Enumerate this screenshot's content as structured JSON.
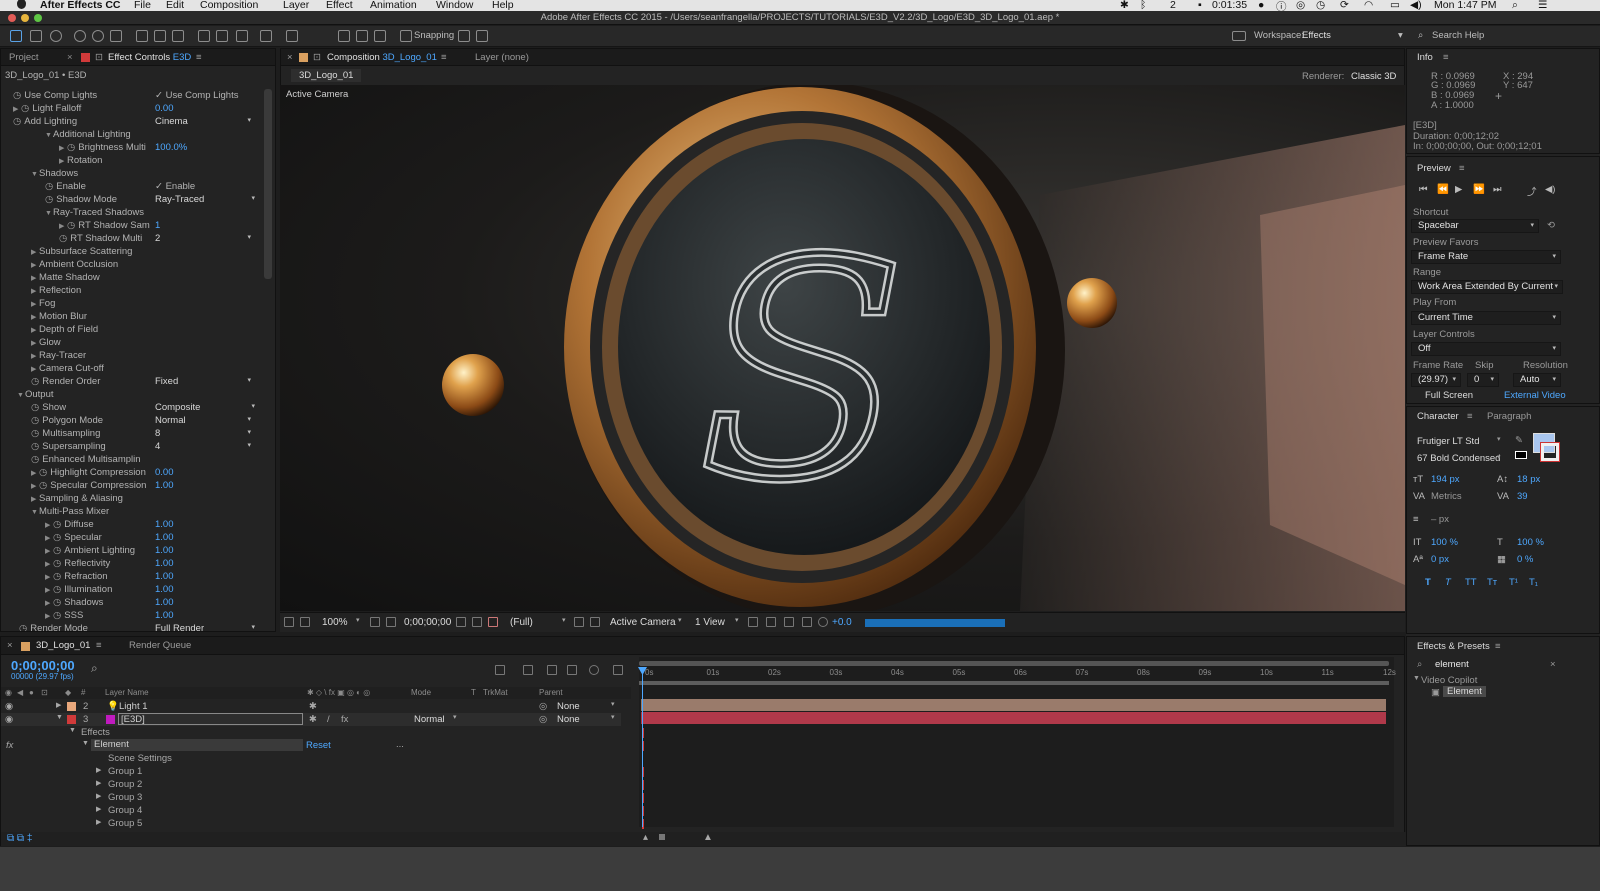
{
  "menubar": {
    "app": "After Effects CC",
    "items": [
      "File",
      "Edit",
      "Composition",
      "Layer",
      "Effect",
      "Animation",
      "Window",
      "Help"
    ],
    "status_count": "2",
    "time_indicator": "0:01:35",
    "clock": "Mon 1:47 PM"
  },
  "window": {
    "title": "Adobe After Effects CC 2015 - /Users/seanfrangella/PROJECTS/TUTORIALS/E3D_V2.2/3D_Logo/E3D_3D_Logo_01.aep *"
  },
  "toolbar": {
    "snapping": "Snapping",
    "workspace_label": "Workspace:",
    "workspace_value": "Effects",
    "search_help": "Search Help"
  },
  "effect_controls": {
    "tabs": {
      "project": "Project",
      "effect_controls_prefix": "Effect Controls",
      "effect_controls_layer": "E3D"
    },
    "header": "3D_Logo_01 • E3D",
    "rows": [
      {
        "label": "Use Comp Lights",
        "value": "✓ Use Comp Lights"
      },
      {
        "label": "Light Falloff",
        "value": "0.00"
      },
      {
        "label": "Add Lighting",
        "value": "Cinema"
      },
      {
        "label": "Additional Lighting",
        "value": ""
      },
      {
        "label": "Brightness Multi",
        "value": "100.0%"
      },
      {
        "label": "Rotation",
        "value": ""
      },
      {
        "label": "Shadows",
        "value": ""
      },
      {
        "label": "Enable",
        "value": "✓ Enable"
      },
      {
        "label": "Shadow Mode",
        "value": "Ray-Traced"
      },
      {
        "label": "Ray-Traced Shadows",
        "value": ""
      },
      {
        "label": "RT Shadow Sam",
        "value": "1"
      },
      {
        "label": "RT Shadow Multi",
        "value": "2"
      },
      {
        "label": "Subsurface Scattering",
        "value": ""
      },
      {
        "label": "Ambient Occlusion",
        "value": ""
      },
      {
        "label": "Matte Shadow",
        "value": ""
      },
      {
        "label": "Reflection",
        "value": ""
      },
      {
        "label": "Fog",
        "value": ""
      },
      {
        "label": "Motion Blur",
        "value": ""
      },
      {
        "label": "Depth of Field",
        "value": ""
      },
      {
        "label": "Glow",
        "value": ""
      },
      {
        "label": "Ray-Tracer",
        "value": ""
      },
      {
        "label": "Camera Cut-off",
        "value": ""
      },
      {
        "label": "Render Order",
        "value": "Fixed"
      },
      {
        "label": "Output",
        "value": ""
      },
      {
        "label": "Show",
        "value": "Composite"
      },
      {
        "label": "Polygon Mode",
        "value": "Normal"
      },
      {
        "label": "Multisampling",
        "value": "8"
      },
      {
        "label": "Supersampling",
        "value": "4"
      },
      {
        "label": "Enhanced Multisamplin",
        "value": ""
      },
      {
        "label": "Highlight Compression",
        "value": "0.00"
      },
      {
        "label": "Specular Compression",
        "value": "1.00"
      },
      {
        "label": "Sampling & Aliasing",
        "value": ""
      },
      {
        "label": "Multi-Pass Mixer",
        "value": ""
      },
      {
        "label": "Diffuse",
        "value": "1.00"
      },
      {
        "label": "Specular",
        "value": "1.00"
      },
      {
        "label": "Ambient Lighting",
        "value": "1.00"
      },
      {
        "label": "Reflectivity",
        "value": "1.00"
      },
      {
        "label": "Refraction",
        "value": "1.00"
      },
      {
        "label": "Illumination",
        "value": "1.00"
      },
      {
        "label": "Shadows",
        "value": "1.00"
      },
      {
        "label": "SSS",
        "value": "1.00"
      },
      {
        "label": "Render Mode",
        "value": "Full Render"
      }
    ]
  },
  "composition": {
    "tab_prefix": "Composition",
    "tab_name": "3D_Logo_01",
    "layer_tab": "Layer (none)",
    "subtab": "3D_Logo_01",
    "renderer_label": "Renderer:",
    "renderer_value": "Classic 3D",
    "camera_label": "Active Camera"
  },
  "viewer_footer": {
    "zoom": "100%",
    "timecode": "0;00;00;00",
    "resolution": "(Full)",
    "camera": "Active Camera",
    "views": "1 View",
    "exposure": "+0.0"
  },
  "timeline": {
    "tabs": {
      "comp": "3D_Logo_01",
      "render_queue": "Render Queue"
    },
    "timecode": "0;00;00;00",
    "fps": "00000 (29.97 fps)",
    "columns": {
      "layer_name": "Layer Name",
      "mode": "Mode",
      "t": "T",
      "trkmat": "TrkMat",
      "parent": "Parent"
    },
    "ruler": [
      "0s",
      "01s",
      "02s",
      "03s",
      "04s",
      "05s",
      "06s",
      "07s",
      "08s",
      "09s",
      "10s",
      "11s",
      "12s"
    ],
    "layers": [
      {
        "num": "2",
        "name": "Light 1",
        "mode": "",
        "parent": "None"
      },
      {
        "num": "3",
        "name": "[E3D]",
        "mode": "Normal",
        "parent": "None"
      }
    ],
    "effects_label": "Effects",
    "element_label": "Element",
    "reset_label": "Reset",
    "reset_dots": "...",
    "children": [
      "Scene Settings",
      "Group 1",
      "Group 2",
      "Group 3",
      "Group 4",
      "Group 5"
    ]
  },
  "info": {
    "title": "Info",
    "r": "R : 0.0969",
    "g": "G : 0.0969",
    "b": "B : 0.0969",
    "a": "A : 1.0000",
    "x": "X : 294",
    "y": "Y : 647",
    "layer": "[E3D]",
    "duration": "Duration: 0;00;12;02",
    "inout": "In: 0;00;00;00, Out: 0;00;12;01"
  },
  "preview": {
    "title": "Preview",
    "shortcut_label": "Shortcut",
    "shortcut": "Spacebar",
    "favors_label": "Preview Favors",
    "favors": "Frame Rate",
    "range_label": "Range",
    "range": "Work Area Extended By Current",
    "playfrom_label": "Play From",
    "playfrom": "Current Time",
    "layerctrl_label": "Layer Controls",
    "layerctrl": "Off",
    "fr_label": "Frame Rate",
    "skip_label": "Skip",
    "res_label": "Resolution",
    "fr": "(29.97)",
    "skip": "0",
    "res": "Auto",
    "fullscreen": "Full Screen",
    "external": "External Video"
  },
  "character": {
    "title": "Character",
    "paragraph": "Paragraph",
    "font": "Frutiger LT Std",
    "style": "67 Bold Condensed",
    "size": "194 px",
    "leading": "18 px",
    "kerning": "Metrics",
    "tracking": "39",
    "stroke": "– px",
    "vscale": "100 %",
    "hscale": "100 %",
    "baseline": "0 px",
    "tsume": "0 %"
  },
  "effects_presets": {
    "title": "Effects & Presets",
    "search": "element",
    "folder": "Video Copilot",
    "item": "Element"
  }
}
